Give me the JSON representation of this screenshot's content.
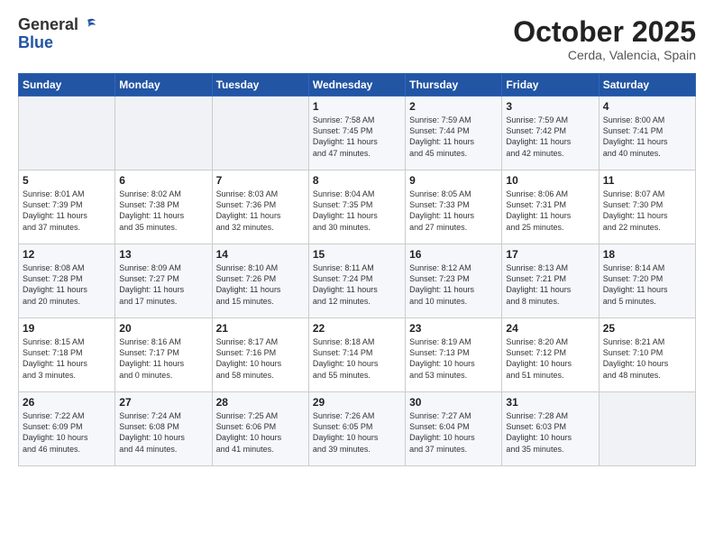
{
  "logo": {
    "general": "General",
    "blue": "Blue"
  },
  "header": {
    "month": "October 2025",
    "location": "Cerda, Valencia, Spain"
  },
  "days_of_week": [
    "Sunday",
    "Monday",
    "Tuesday",
    "Wednesday",
    "Thursday",
    "Friday",
    "Saturday"
  ],
  "weeks": [
    [
      {
        "day": "",
        "info": ""
      },
      {
        "day": "",
        "info": ""
      },
      {
        "day": "",
        "info": ""
      },
      {
        "day": "1",
        "info": "Sunrise: 7:58 AM\nSunset: 7:45 PM\nDaylight: 11 hours\nand 47 minutes."
      },
      {
        "day": "2",
        "info": "Sunrise: 7:59 AM\nSunset: 7:44 PM\nDaylight: 11 hours\nand 45 minutes."
      },
      {
        "day": "3",
        "info": "Sunrise: 7:59 AM\nSunset: 7:42 PM\nDaylight: 11 hours\nand 42 minutes."
      },
      {
        "day": "4",
        "info": "Sunrise: 8:00 AM\nSunset: 7:41 PM\nDaylight: 11 hours\nand 40 minutes."
      }
    ],
    [
      {
        "day": "5",
        "info": "Sunrise: 8:01 AM\nSunset: 7:39 PM\nDaylight: 11 hours\nand 37 minutes."
      },
      {
        "day": "6",
        "info": "Sunrise: 8:02 AM\nSunset: 7:38 PM\nDaylight: 11 hours\nand 35 minutes."
      },
      {
        "day": "7",
        "info": "Sunrise: 8:03 AM\nSunset: 7:36 PM\nDaylight: 11 hours\nand 32 minutes."
      },
      {
        "day": "8",
        "info": "Sunrise: 8:04 AM\nSunset: 7:35 PM\nDaylight: 11 hours\nand 30 minutes."
      },
      {
        "day": "9",
        "info": "Sunrise: 8:05 AM\nSunset: 7:33 PM\nDaylight: 11 hours\nand 27 minutes."
      },
      {
        "day": "10",
        "info": "Sunrise: 8:06 AM\nSunset: 7:31 PM\nDaylight: 11 hours\nand 25 minutes."
      },
      {
        "day": "11",
        "info": "Sunrise: 8:07 AM\nSunset: 7:30 PM\nDaylight: 11 hours\nand 22 minutes."
      }
    ],
    [
      {
        "day": "12",
        "info": "Sunrise: 8:08 AM\nSunset: 7:28 PM\nDaylight: 11 hours\nand 20 minutes."
      },
      {
        "day": "13",
        "info": "Sunrise: 8:09 AM\nSunset: 7:27 PM\nDaylight: 11 hours\nand 17 minutes."
      },
      {
        "day": "14",
        "info": "Sunrise: 8:10 AM\nSunset: 7:26 PM\nDaylight: 11 hours\nand 15 minutes."
      },
      {
        "day": "15",
        "info": "Sunrise: 8:11 AM\nSunset: 7:24 PM\nDaylight: 11 hours\nand 12 minutes."
      },
      {
        "day": "16",
        "info": "Sunrise: 8:12 AM\nSunset: 7:23 PM\nDaylight: 11 hours\nand 10 minutes."
      },
      {
        "day": "17",
        "info": "Sunrise: 8:13 AM\nSunset: 7:21 PM\nDaylight: 11 hours\nand 8 minutes."
      },
      {
        "day": "18",
        "info": "Sunrise: 8:14 AM\nSunset: 7:20 PM\nDaylight: 11 hours\nand 5 minutes."
      }
    ],
    [
      {
        "day": "19",
        "info": "Sunrise: 8:15 AM\nSunset: 7:18 PM\nDaylight: 11 hours\nand 3 minutes."
      },
      {
        "day": "20",
        "info": "Sunrise: 8:16 AM\nSunset: 7:17 PM\nDaylight: 11 hours\nand 0 minutes."
      },
      {
        "day": "21",
        "info": "Sunrise: 8:17 AM\nSunset: 7:16 PM\nDaylight: 10 hours\nand 58 minutes."
      },
      {
        "day": "22",
        "info": "Sunrise: 8:18 AM\nSunset: 7:14 PM\nDaylight: 10 hours\nand 55 minutes."
      },
      {
        "day": "23",
        "info": "Sunrise: 8:19 AM\nSunset: 7:13 PM\nDaylight: 10 hours\nand 53 minutes."
      },
      {
        "day": "24",
        "info": "Sunrise: 8:20 AM\nSunset: 7:12 PM\nDaylight: 10 hours\nand 51 minutes."
      },
      {
        "day": "25",
        "info": "Sunrise: 8:21 AM\nSunset: 7:10 PM\nDaylight: 10 hours\nand 48 minutes."
      }
    ],
    [
      {
        "day": "26",
        "info": "Sunrise: 7:22 AM\nSunset: 6:09 PM\nDaylight: 10 hours\nand 46 minutes."
      },
      {
        "day": "27",
        "info": "Sunrise: 7:24 AM\nSunset: 6:08 PM\nDaylight: 10 hours\nand 44 minutes."
      },
      {
        "day": "28",
        "info": "Sunrise: 7:25 AM\nSunset: 6:06 PM\nDaylight: 10 hours\nand 41 minutes."
      },
      {
        "day": "29",
        "info": "Sunrise: 7:26 AM\nSunset: 6:05 PM\nDaylight: 10 hours\nand 39 minutes."
      },
      {
        "day": "30",
        "info": "Sunrise: 7:27 AM\nSunset: 6:04 PM\nDaylight: 10 hours\nand 37 minutes."
      },
      {
        "day": "31",
        "info": "Sunrise: 7:28 AM\nSunset: 6:03 PM\nDaylight: 10 hours\nand 35 minutes."
      },
      {
        "day": "",
        "info": ""
      }
    ]
  ]
}
